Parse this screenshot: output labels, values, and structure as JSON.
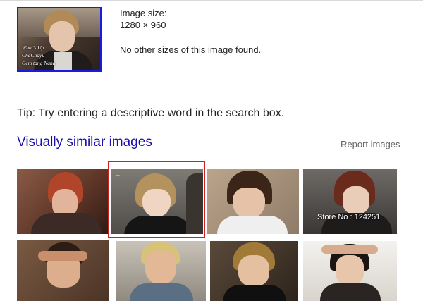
{
  "query_image": {
    "caption_lines": [
      "What's Up",
      "ChaChayu",
      "Gem tang Nana"
    ]
  },
  "image_size": {
    "label": "Image size:",
    "value": "1280 × 960",
    "no_other_sizes": "No other sizes of this image found."
  },
  "tip": "Tip: Try entering a descriptive word in the search box.",
  "similar": {
    "title": "Visually similar images",
    "report_label": "Report images",
    "store_overlay": "Store No : 124251"
  },
  "colors": {
    "link_blue": "#1a0dab",
    "highlight_red": "#d01f1f",
    "thumb_border": "#1a1ae0"
  }
}
